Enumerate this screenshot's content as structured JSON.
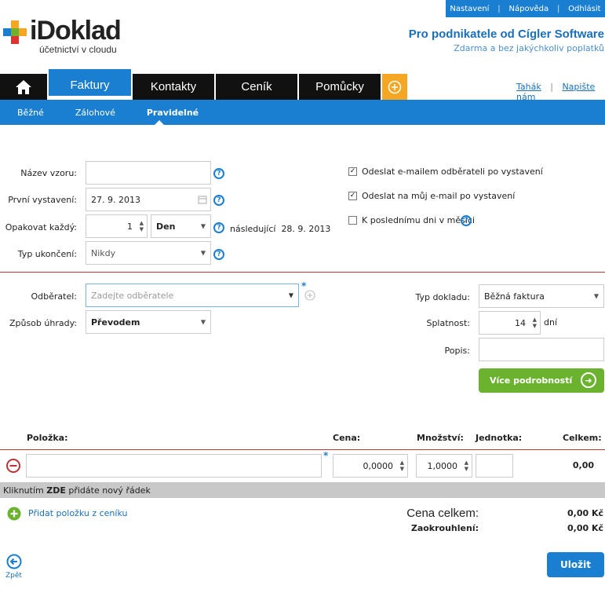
{
  "top_links": {
    "settings": "Nastavení",
    "help": "Nápověda",
    "logout": "Odhlásit",
    "sep": "|"
  },
  "brand": {
    "logo_text": "iDoklad",
    "logo_sub": "účetnictví v cloudu",
    "tagline": "Pro podnikatele od Cígler Software",
    "tagline_sub": "Zdarma a bez jakýchkoliv poplatků"
  },
  "colors": {
    "accent": "#1a7fd1",
    "green": "#6bb22f",
    "orange": "#f5a623",
    "danger": "#b33333"
  },
  "nav": {
    "home_icon": "home-icon",
    "tabs": [
      {
        "label": "Faktury"
      },
      {
        "label": "Kontakty"
      },
      {
        "label": "Ceník"
      },
      {
        "label": "Pomůcky"
      }
    ],
    "add_icon": "plus-circle-icon",
    "right_links": {
      "cheatsheet": "Tahák",
      "sep": "|",
      "write_us": "Napište nám"
    }
  },
  "subnav": {
    "items": [
      {
        "label": "Běžné"
      },
      {
        "label": "Zálohové"
      },
      {
        "label": "Pravidelné"
      }
    ]
  },
  "form": {
    "template_name_label": "Název vzoru:",
    "template_name_value": "",
    "first_issue_label": "První vystavení:",
    "first_issue_value": "27. 9. 2013",
    "repeat_label": "Opakovat každý:",
    "repeat_value": "1",
    "repeat_unit": "Den",
    "next_label": "následující",
    "next_value": "28. 9. 2013",
    "end_type_label": "Typ ukončení:",
    "end_type_value": "Nikdy",
    "opt_email_customer": "Odeslat e-mailem odběrateli po vystavení",
    "opt_email_me": "Odeslat na můj e-mail po vystavení",
    "opt_last_day": "K poslednímu dni v měsíci",
    "check_mark": "✓",
    "customer_label": "Odběratel:",
    "customer_placeholder": "Zadejte odběratele",
    "payment_label": "Způsob úhrady:",
    "payment_value": "Převodem",
    "doc_type_label": "Typ dokladu:",
    "doc_type_value": "Běžná faktura",
    "due_label": "Splatnost:",
    "due_value": "14",
    "due_unit": "dní",
    "desc_label": "Popis:",
    "desc_value": "",
    "more_button": "Více podrobností",
    "required_mark": "*"
  },
  "items": {
    "headers": {
      "item": "Položka:",
      "price": "Cena:",
      "qty": "Množství:",
      "unit": "Jednotka:",
      "total": "Celkem:"
    },
    "row": {
      "name": "",
      "price": "0,0000",
      "qty": "1,0000",
      "unit": "",
      "total": "0,00"
    },
    "add_row_prefix": "Kliknutím",
    "add_row_bold": "ZDE",
    "add_row_suffix": "přidáte nový řádek",
    "add_from_pricelist": "Přidat položku z ceníku",
    "total_label": "Cena celkem:",
    "total_value": "0,00 Kč",
    "rounding_label": "Zaokrouhlení:",
    "rounding_value": "0,00 Kč"
  },
  "footer": {
    "back_label": "Zpět",
    "save_label": "Uložit"
  }
}
